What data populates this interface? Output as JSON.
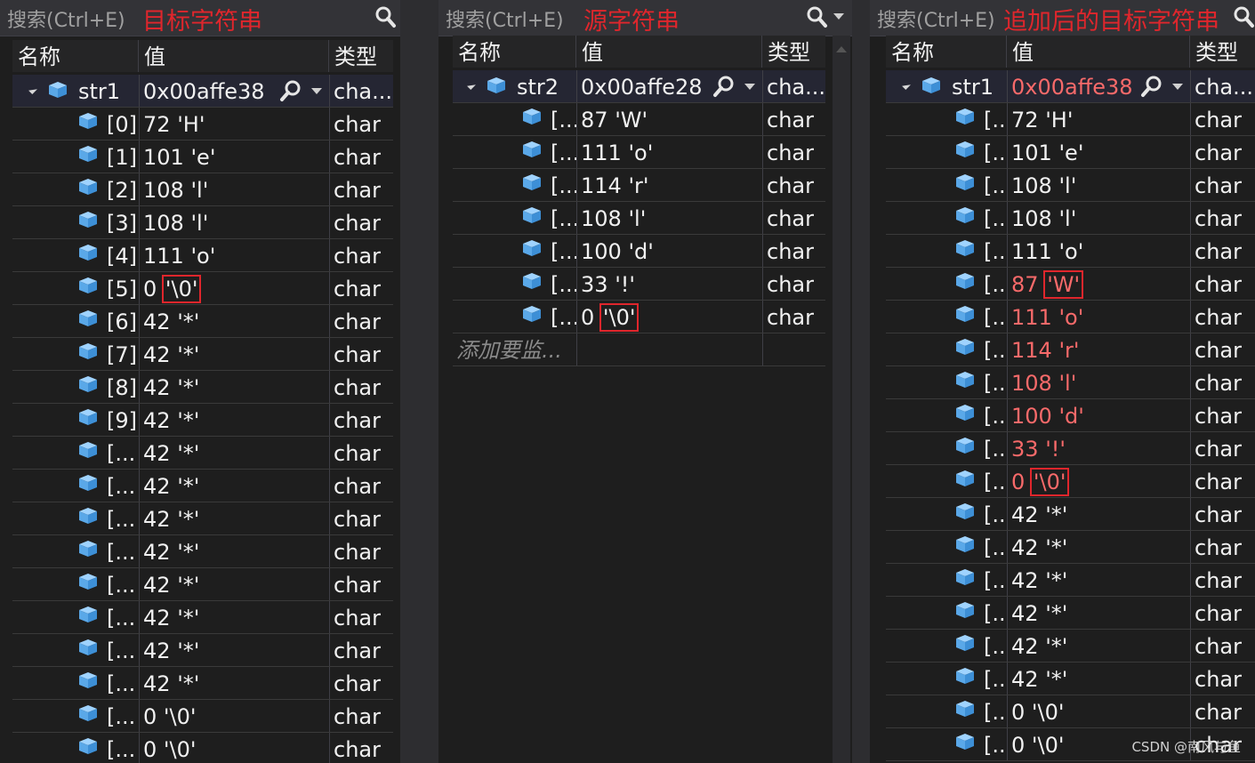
{
  "colors": {
    "background": "#1e1e1e",
    "annotation": "#e0262c",
    "changed_value": "#f86a6a",
    "cube_icon": "#75beff"
  },
  "panels": [
    {
      "search_placeholder": "搜索(Ctrl+E)",
      "annotation": "目标字符串",
      "headers": {
        "name": "名称",
        "value": "值",
        "type": "类型"
      },
      "root": {
        "name": "str1",
        "value": "0x00affe38 ...",
        "type": "cha..."
      },
      "items": [
        {
          "index": "[0]",
          "num": "72",
          "chr": "'H'",
          "type": "char"
        },
        {
          "index": "[1]",
          "num": "101",
          "chr": "'e'",
          "type": "char"
        },
        {
          "index": "[2]",
          "num": "108",
          "chr": "'l'",
          "type": "char"
        },
        {
          "index": "[3]",
          "num": "108",
          "chr": "'l'",
          "type": "char"
        },
        {
          "index": "[4]",
          "num": "111",
          "chr": "'o'",
          "type": "char"
        },
        {
          "index": "[5]",
          "num": "0",
          "chr": "'\\0'",
          "type": "char",
          "boxed": true
        },
        {
          "index": "[6]",
          "num": "42",
          "chr": "'*'",
          "type": "char"
        },
        {
          "index": "[7]",
          "num": "42",
          "chr": "'*'",
          "type": "char"
        },
        {
          "index": "[8]",
          "num": "42",
          "chr": "'*'",
          "type": "char"
        },
        {
          "index": "[9]",
          "num": "42",
          "chr": "'*'",
          "type": "char"
        },
        {
          "index": "[...",
          "num": "42",
          "chr": "'*'",
          "type": "char"
        },
        {
          "index": "[...",
          "num": "42",
          "chr": "'*'",
          "type": "char"
        },
        {
          "index": "[...",
          "num": "42",
          "chr": "'*'",
          "type": "char"
        },
        {
          "index": "[...",
          "num": "42",
          "chr": "'*'",
          "type": "char"
        },
        {
          "index": "[...",
          "num": "42",
          "chr": "'*'",
          "type": "char"
        },
        {
          "index": "[...",
          "num": "42",
          "chr": "'*'",
          "type": "char"
        },
        {
          "index": "[...",
          "num": "42",
          "chr": "'*'",
          "type": "char"
        },
        {
          "index": "[...",
          "num": "42",
          "chr": "'*'",
          "type": "char"
        },
        {
          "index": "[...",
          "num": "0",
          "chr": "'\\0'",
          "type": "char"
        },
        {
          "index": "[...",
          "num": "0",
          "chr": "'\\0'",
          "type": "char"
        }
      ]
    },
    {
      "search_placeholder": "搜索(Ctrl+E)",
      "annotation": "源字符串",
      "headers": {
        "name": "名称",
        "value": "值",
        "type": "类型"
      },
      "root": {
        "name": "str2",
        "value": "0x00affe28...",
        "type": "cha..."
      },
      "items": [
        {
          "index": "[...",
          "num": "87",
          "chr": "'W'",
          "type": "char"
        },
        {
          "index": "[...",
          "num": "111",
          "chr": "'o'",
          "type": "char"
        },
        {
          "index": "[...",
          "num": "114",
          "chr": "'r'",
          "type": "char"
        },
        {
          "index": "[...",
          "num": "108",
          "chr": "'l'",
          "type": "char"
        },
        {
          "index": "[...",
          "num": "100",
          "chr": "'d'",
          "type": "char"
        },
        {
          "index": "[...",
          "num": "33",
          "chr": "'!'",
          "type": "char"
        },
        {
          "index": "[...",
          "num": "0",
          "chr": "'\\0'",
          "type": "char",
          "boxed": true
        }
      ],
      "add_watch": "添加要监..."
    },
    {
      "search_placeholder": "搜索(Ctrl+E)",
      "annotation": "追加后的目标字符串",
      "headers": {
        "name": "名称",
        "value": "值",
        "type": "类型"
      },
      "root": {
        "name": "str1",
        "value": "0x00affe38...",
        "type": "cha...",
        "changed": true
      },
      "items": [
        {
          "index": "[...",
          "num": "72",
          "chr": "'H'",
          "type": "char"
        },
        {
          "index": "[...",
          "num": "101",
          "chr": "'e'",
          "type": "char"
        },
        {
          "index": "[...",
          "num": "108",
          "chr": "'l'",
          "type": "char"
        },
        {
          "index": "[...",
          "num": "108",
          "chr": "'l'",
          "type": "char"
        },
        {
          "index": "[...",
          "num": "111",
          "chr": "'o'",
          "type": "char"
        },
        {
          "index": "[...",
          "num": "87",
          "chr": "'W'",
          "type": "char",
          "changed": true,
          "boxed": true
        },
        {
          "index": "[...",
          "num": "111",
          "chr": "'o'",
          "type": "char",
          "changed": true
        },
        {
          "index": "[...",
          "num": "114",
          "chr": "'r'",
          "type": "char",
          "changed": true
        },
        {
          "index": "[...",
          "num": "108",
          "chr": "'l'",
          "type": "char",
          "changed": true
        },
        {
          "index": "[...",
          "num": "100",
          "chr": "'d'",
          "type": "char",
          "changed": true
        },
        {
          "index": "[...",
          "num": "33",
          "chr": "'!'",
          "type": "char",
          "changed": true
        },
        {
          "index": "[...",
          "num": "0",
          "chr": "'\\0'",
          "type": "char",
          "changed": true,
          "boxed": true
        },
        {
          "index": "[...",
          "num": "42",
          "chr": "'*'",
          "type": "char"
        },
        {
          "index": "[...",
          "num": "42",
          "chr": "'*'",
          "type": "char"
        },
        {
          "index": "[...",
          "num": "42",
          "chr": "'*'",
          "type": "char"
        },
        {
          "index": "[...",
          "num": "42",
          "chr": "'*'",
          "type": "char"
        },
        {
          "index": "[...",
          "num": "42",
          "chr": "'*'",
          "type": "char"
        },
        {
          "index": "[...",
          "num": "42",
          "chr": "'*'",
          "type": "char"
        },
        {
          "index": "[...",
          "num": "0",
          "chr": "'\\0'",
          "type": "char"
        },
        {
          "index": "[...",
          "num": "0",
          "chr": "'\\0'",
          "type": "char"
        }
      ]
    }
  ],
  "watermark": "CSDN @南风与鱼"
}
